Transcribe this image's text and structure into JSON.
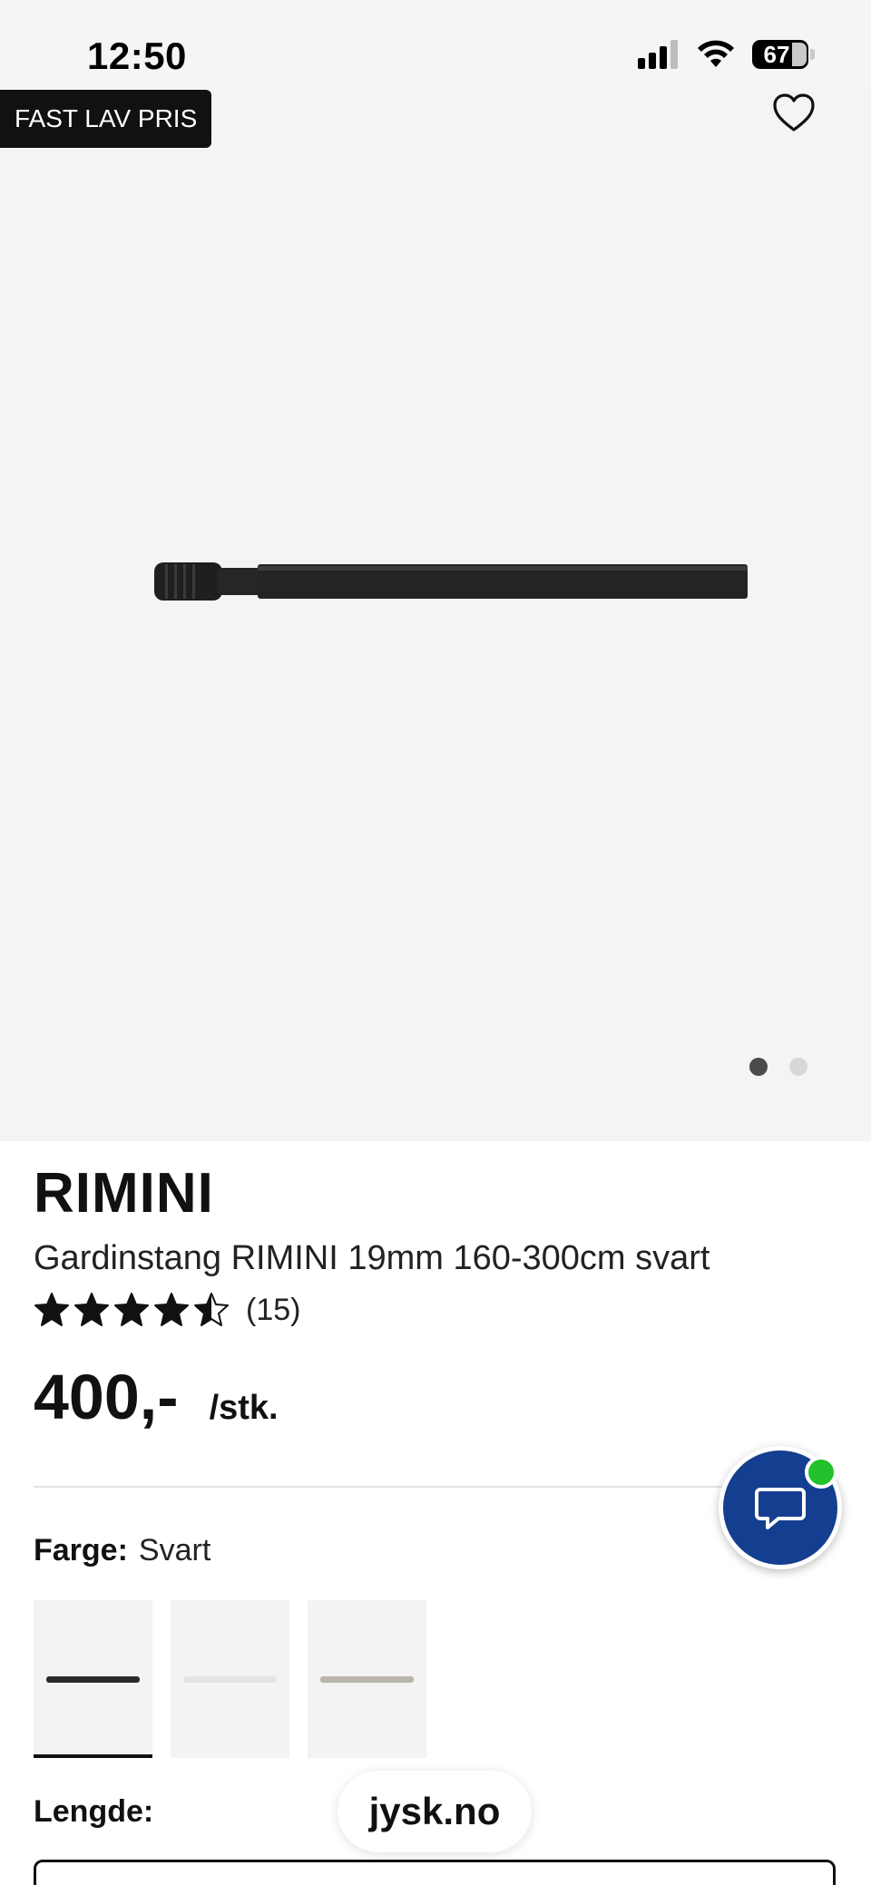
{
  "status_bar": {
    "time": "12:50",
    "battery": "67"
  },
  "hero": {
    "badge": "FAST LAV PRIS",
    "image_count": 2,
    "active_image": 1
  },
  "product": {
    "brand": "RIMINI",
    "name": "Gardinstang RIMINI 19mm 160-300cm svart",
    "rating": 4.5,
    "rating_max": 5,
    "review_count": "(15)",
    "price": "400,-",
    "unit": "/stk."
  },
  "color": {
    "label": "Farge:",
    "value": "Svart",
    "swatches": [
      {
        "name": "Svart",
        "rod_color": "#2b2b2b",
        "selected": true
      },
      {
        "name": "Hvit",
        "rod_color": "#e4e4e4",
        "selected": false
      },
      {
        "name": "Stål",
        "rod_color": "#b8b4aa",
        "selected": false
      }
    ]
  },
  "length": {
    "label": "Lengde:"
  },
  "browser": {
    "url": "jysk.no"
  },
  "colors": {
    "chat_button": "#143e8f",
    "online_indicator": "#21c22b",
    "badge_bg": "#111111"
  }
}
